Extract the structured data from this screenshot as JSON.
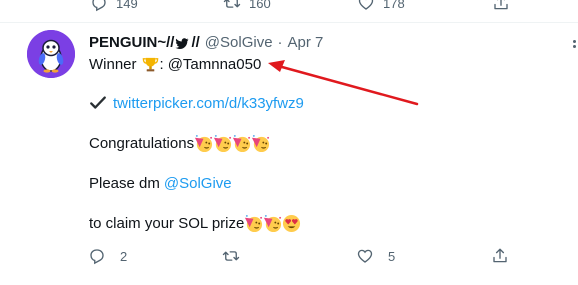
{
  "prev_tweet": {
    "replies": "149",
    "retweets": "160",
    "likes": "178"
  },
  "tweet": {
    "display_name": "PENGUIN~//",
    "name_suffix": "//",
    "handle": "@SolGive",
    "separator": "·",
    "date": "Apr 7",
    "line1_prefix": "Winner",
    "line1_sep": ":",
    "winner_handle": "@Tamnna050",
    "link": "twitterpicker.com/d/k33yfwz9",
    "congrats": "Congratulations",
    "dm_prefix": "Please dm",
    "dm_handle": "@SolGive",
    "claim": "to claim your SOL prize"
  },
  "actions": {
    "replies": "2",
    "retweets": "",
    "likes": "5"
  },
  "colors": {
    "accent": "#1d9bf0",
    "muted": "#536471",
    "annotation_arrow": "#e0191e",
    "avatar_bg": "#7b3fe4"
  },
  "icons": {
    "trophy": "trophy-icon",
    "check": "check-mark-icon",
    "party": "partying-face-emoji",
    "hearts": "heart-eyes-emoji"
  }
}
